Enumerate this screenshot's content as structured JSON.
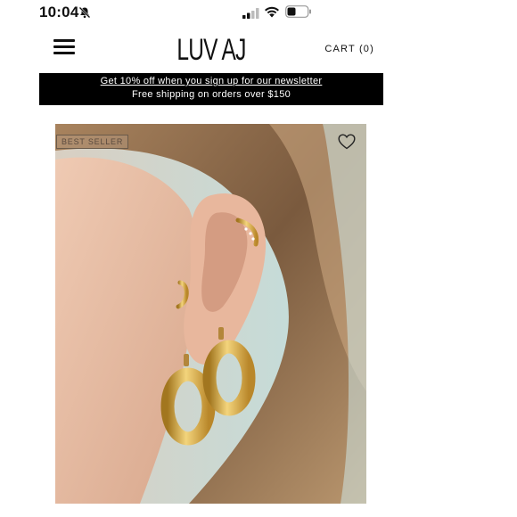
{
  "status_bar": {
    "time": "10:04",
    "icons": [
      "bell-off-icon",
      "signal-icon",
      "wifi-icon",
      "battery-icon"
    ]
  },
  "header": {
    "menu_icon": "hamburger-menu-icon",
    "logo": "LUV AJ",
    "cart_label": "CART (0)"
  },
  "promo": {
    "line1": "Get 10% off when you sign up for our newsletter",
    "line2": "Free shipping on orders over $150"
  },
  "product": {
    "badge": "BEST SELLER",
    "wishlist_icon": "heart-icon",
    "image_description_icon": "product-photo"
  },
  "colors": {
    "banner_bg": "#000000",
    "banner_text": "#ffffff",
    "gold": "#d4a53a",
    "hair": "#8a6a4a",
    "skin": "#e3b9a0"
  }
}
